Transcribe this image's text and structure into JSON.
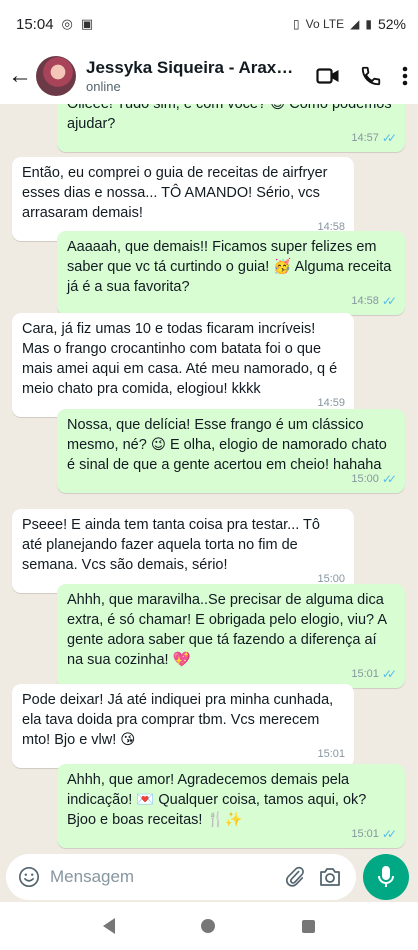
{
  "status_bar": {
    "time": "15:04",
    "right_indicators": "Vo LTE",
    "battery": "52%"
  },
  "header": {
    "contact_name": "Jessyka Siqueira - Araxá...",
    "contact_status": "online"
  },
  "messages": [
    {
      "direction": "out",
      "text": "Olieee! Tudo sim, e com você? 😊 Como podemos ajudar?",
      "time": "14:57",
      "read": true
    },
    {
      "direction": "in",
      "text": "Então, eu comprei o guia de receitas de airfryer esses dias e nossa... TÔ AMANDO! Sério, vcs arrasaram demais!",
      "time": "14:58"
    },
    {
      "direction": "out",
      "text": "Aaaaah, que demais!! Ficamos super felizes em saber que vc tá curtindo o guia! 🥳 Alguma receita já é a sua favorita?",
      "time": "14:58",
      "read": true
    },
    {
      "direction": "in",
      "text": "Cara, já fiz umas 10 e todas ficaram incríveis! Mas o frango crocantinho com batata foi o que mais amei aqui em casa. Até meu namorado, q é meio chato pra comida, elogiou! kkkk",
      "time": "14:59"
    },
    {
      "direction": "out",
      "text": "Nossa, que delícia! Esse frango é um clássico mesmo, né? 😉 E olha, elogio de namorado chato é sinal de que a gente acertou em cheio! hahaha",
      "time": "15:00",
      "read": true
    },
    {
      "direction": "in",
      "text": "Pseee! E ainda tem tanta coisa pra testar... Tô até planejando fazer aquela torta no fim de semana. Vcs são demais, sério!",
      "time": "15:00"
    },
    {
      "direction": "out",
      "text": "Ahhh, que maravilha..Se precisar de alguma dica extra, é só chamar! E obrigada pelo elogio, viu? A gente adora saber que tá fazendo a diferença aí na sua cozinha! 💖",
      "time": "15:01",
      "read": true
    },
    {
      "direction": "in",
      "text": "Pode deixar! Já até indiquei pra minha cunhada, ela tava doida pra comprar tbm. Vcs merecem mto! Bjo e vlw! 😘",
      "time": "15:01"
    },
    {
      "direction": "out",
      "text": "Ahhh, que amor! Agradecemos demais pela indicação! 💌 Qualquer coisa, tamos aqui, ok? Bjoo e boas receitas! 🍴✨",
      "time": "15:01",
      "read": true
    }
  ],
  "composer": {
    "placeholder": "Mensagem"
  },
  "colors": {
    "chat_background": "#efeae2",
    "outgoing_bubble": "#d9fdd3",
    "incoming_bubble": "#ffffff",
    "read_ticks": "#53bdeb",
    "mic_button": "#00a884"
  }
}
